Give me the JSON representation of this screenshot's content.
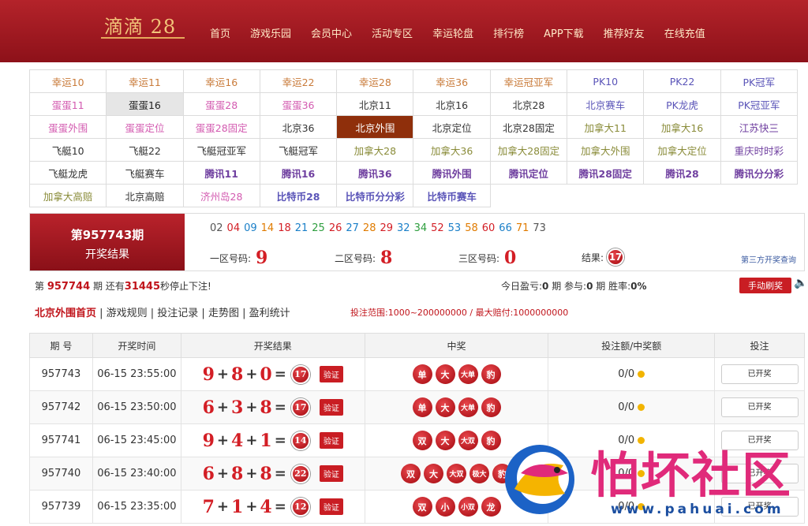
{
  "header": {
    "logo": "滴滴 28",
    "nav": [
      "首页",
      "游戏乐园",
      "会员中心",
      "活动专区",
      "幸运轮盘",
      "排行榜",
      "APP下载",
      "推荐好友",
      "在线充值"
    ]
  },
  "games": [
    [
      {
        "t": "幸运10",
        "c": "o"
      },
      {
        "t": "幸运11",
        "c": "o"
      },
      {
        "t": "幸运16",
        "c": "o"
      },
      {
        "t": "幸运22",
        "c": "o"
      },
      {
        "t": "幸运28",
        "c": "o"
      },
      {
        "t": "幸运36",
        "c": "o"
      },
      {
        "t": "幸运冠亚军",
        "c": "o"
      },
      {
        "t": "PK10",
        "c": "bl"
      },
      {
        "t": "PK22",
        "c": "bl"
      },
      {
        "t": "PK冠军",
        "c": "bl"
      }
    ],
    [
      {
        "t": "蛋蛋11",
        "c": "p"
      },
      {
        "t": "蛋蛋16",
        "c": "k",
        "s": "sel"
      },
      {
        "t": "蛋蛋28",
        "c": "p"
      },
      {
        "t": "蛋蛋36",
        "c": "p"
      },
      {
        "t": "北京11",
        "c": "k"
      },
      {
        "t": "北京16",
        "c": "k"
      },
      {
        "t": "北京28",
        "c": "k"
      },
      {
        "t": "北京赛车",
        "c": "bl"
      },
      {
        "t": "PK龙虎",
        "c": "bl"
      },
      {
        "t": "PK冠亚军",
        "c": "bl"
      }
    ],
    [
      {
        "t": "蛋蛋外围",
        "c": "p"
      },
      {
        "t": "蛋蛋定位",
        "c": "p"
      },
      {
        "t": "蛋蛋28固定",
        "c": "p"
      },
      {
        "t": "北京36",
        "c": "k"
      },
      {
        "t": "北京外围",
        "c": "k",
        "s": "act"
      },
      {
        "t": "北京定位",
        "c": "k"
      },
      {
        "t": "北京28固定",
        "c": "k"
      },
      {
        "t": "加拿大11",
        "c": "g"
      },
      {
        "t": "加拿大16",
        "c": "g"
      },
      {
        "t": "江苏快三",
        "c": "pp"
      }
    ],
    [
      {
        "t": "飞艇10",
        "c": "k"
      },
      {
        "t": "飞艇22",
        "c": "k"
      },
      {
        "t": "飞艇冠亚军",
        "c": "k"
      },
      {
        "t": "飞艇冠军",
        "c": "k"
      },
      {
        "t": "加拿大28",
        "c": "g"
      },
      {
        "t": "加拿大36",
        "c": "g"
      },
      {
        "t": "加拿大28固定",
        "c": "g"
      },
      {
        "t": "加拿大外围",
        "c": "g"
      },
      {
        "t": "加拿大定位",
        "c": "g"
      },
      {
        "t": "重庆时时彩",
        "c": "pp"
      }
    ],
    [
      {
        "t": "飞艇龙虎",
        "c": "k"
      },
      {
        "t": "飞艇赛车",
        "c": "k"
      },
      {
        "t": "腾讯11",
        "c": "pp",
        "b": 1
      },
      {
        "t": "腾讯16",
        "c": "pp",
        "b": 1
      },
      {
        "t": "腾讯36",
        "c": "pp",
        "b": 1
      },
      {
        "t": "腾讯外围",
        "c": "pp",
        "b": 1
      },
      {
        "t": "腾讯定位",
        "c": "pp",
        "b": 1
      },
      {
        "t": "腾讯28固定",
        "c": "pp",
        "b": 1
      },
      {
        "t": "腾讯28",
        "c": "pp",
        "b": 1
      },
      {
        "t": "腾讯分分彩",
        "c": "pp",
        "b": 1
      }
    ],
    [
      {
        "t": "加拿大高赔",
        "c": "g"
      },
      {
        "t": "北京高赔",
        "c": "k"
      },
      {
        "t": "济州岛28",
        "c": "p"
      },
      {
        "t": "比特币28",
        "c": "bl",
        "b": 1
      },
      {
        "t": "比特币分分彩",
        "c": "bl",
        "b": 1
      },
      {
        "t": "比特币赛车",
        "c": "bl",
        "b": 1
      }
    ]
  ],
  "result": {
    "period": "第957743期",
    "label": "开奖结果",
    "numbers": [
      {
        "n": "02",
        "c": "#555"
      },
      {
        "n": "04",
        "c": "#d31e25"
      },
      {
        "n": "09",
        "c": "#1a7fc8"
      },
      {
        "n": "14",
        "c": "#e07b00"
      },
      {
        "n": "18",
        "c": "#d31e25"
      },
      {
        "n": "21",
        "c": "#1a7fc8"
      },
      {
        "n": "25",
        "c": "#2e9e3e"
      },
      {
        "n": "26",
        "c": "#d31e25"
      },
      {
        "n": "27",
        "c": "#1a7fc8"
      },
      {
        "n": "28",
        "c": "#e07b00"
      },
      {
        "n": "29",
        "c": "#d31e25"
      },
      {
        "n": "32",
        "c": "#1a7fc8"
      },
      {
        "n": "34",
        "c": "#2e9e3e"
      },
      {
        "n": "52",
        "c": "#d31e25"
      },
      {
        "n": "53",
        "c": "#1a7fc8"
      },
      {
        "n": "58",
        "c": "#e07b00"
      },
      {
        "n": "60",
        "c": "#d31e25"
      },
      {
        "n": "66",
        "c": "#1a7fc8"
      },
      {
        "n": "71",
        "c": "#e07b00"
      },
      {
        "n": "73",
        "c": "#555"
      }
    ],
    "zone1_label": "一区号码:",
    "zone1": "9",
    "zone2_label": "二区号码:",
    "zone2": "8",
    "zone3_label": "三区号码:",
    "zone3": "0",
    "sum_label": "结果:",
    "sum": "17",
    "third": "第三方开奖查询"
  },
  "info": {
    "p1": "第",
    "next": "957744",
    "p2": "期 还有",
    "secs": "31445",
    "p3": "秒停止下注!",
    "today_label": "今日盈亏:",
    "today": "0",
    "bet_label": "期 参与:",
    "bet": "0",
    "win_label": "期 胜率:",
    "rate": "0%",
    "auto_btn": "手动刷奖"
  },
  "links": {
    "first": "北京外围首页",
    "rest": " | 游戏规则 | 投注记录 | 走势图 | 盈利统计",
    "range": "投注范围:1000~200000000 / 最大赔付:1000000000"
  },
  "table": {
    "headers": [
      "期 号",
      "开奖时间",
      "开奖结果",
      "中奖",
      "投注额/中奖额",
      "投注"
    ],
    "rows": [
      {
        "id": "957743",
        "time": "06-15 23:55:00",
        "a": "9",
        "b": "8",
        "c": "0",
        "sum": "17",
        "wins": [
          "单",
          "大",
          "大单",
          "豹"
        ],
        "amount": "0/0",
        "status": "已开奖"
      },
      {
        "id": "957742",
        "time": "06-15 23:50:00",
        "a": "6",
        "b": "3",
        "c": "8",
        "sum": "17",
        "wins": [
          "单",
          "大",
          "大单",
          "豹"
        ],
        "amount": "0/0",
        "status": "已开奖"
      },
      {
        "id": "957741",
        "time": "06-15 23:45:00",
        "a": "9",
        "b": "4",
        "c": "1",
        "sum": "14",
        "wins": [
          "双",
          "大",
          "大双",
          "豹"
        ],
        "amount": "0/0",
        "status": "已开奖"
      },
      {
        "id": "957740",
        "time": "06-15 23:40:00",
        "a": "6",
        "b": "8",
        "c": "8",
        "sum": "22",
        "wins": [
          "双",
          "大",
          "大双",
          "极大",
          "豹"
        ],
        "amount": "0/0",
        "status": "已开奖"
      },
      {
        "id": "957739",
        "time": "06-15 23:35:00",
        "a": "7",
        "b": "1",
        "c": "4",
        "sum": "12",
        "wins": [
          "双",
          "小",
          "小双",
          "龙"
        ],
        "amount": "0/0",
        "status": "已开奖"
      }
    ],
    "verify": "验证",
    "plus": "+",
    "eq": "="
  },
  "watermark": {
    "title": "怕坏社区",
    "url": "www.pahuai.com"
  }
}
